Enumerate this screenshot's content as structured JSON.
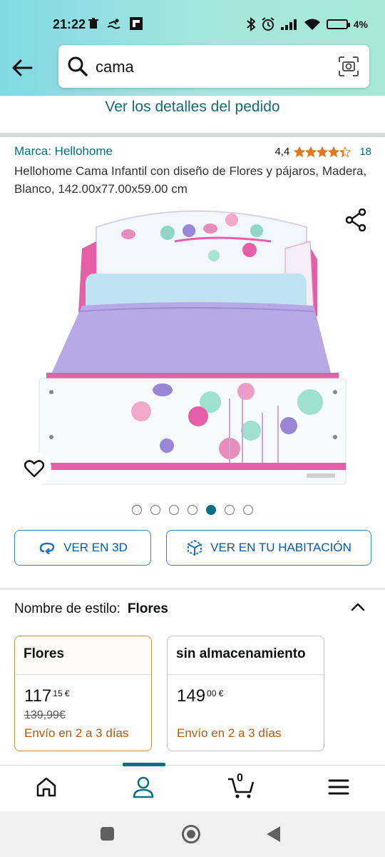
{
  "status": {
    "time": "21:22",
    "battery": "4%",
    "icons": [
      "trash-icon",
      "swim-icon",
      "flipboard-icon",
      "bluetooth-icon",
      "alarm-icon",
      "signal-icon",
      "wifi-icon",
      "battery-icon"
    ]
  },
  "search": {
    "query": "cama"
  },
  "order_details_link": "Ver los detalles del pedido",
  "product": {
    "brand": "Marca: Hellohome",
    "rating": "4,4",
    "stars": 4.4,
    "rating_count": "18",
    "title": "Hellohome Cama Infantil con diseño de Flores y pájaros, Madera, Blanco, 142.00x77.00x59.00 cm",
    "image_count": 7,
    "active_image": 5
  },
  "buttons": {
    "view_3d": "VER EN 3D",
    "view_room": "VER EN TU HABITACIÓN"
  },
  "style": {
    "label": "Nombre de estilo:",
    "selected": "Flores",
    "options": [
      {
        "name": "Flores",
        "price_main": "117",
        "price_cents": "15 €",
        "old_price": "139,99€",
        "delivery": "Envío en 2 a 3 días"
      },
      {
        "name": "sin almacenamiento",
        "price_main": "149",
        "price_cents": "00 €",
        "old_price": "",
        "delivery": "Envío en 2 a 3 días"
      }
    ]
  },
  "bottom_nav": {
    "items": [
      "home-icon",
      "account-icon",
      "cart-icon",
      "menu-icon"
    ],
    "cart_count": "0",
    "active": "account"
  },
  "colors": {
    "header_gradient_start": "#82d8e3",
    "header_gradient_end": "#a9e8d6",
    "link": "#007185",
    "star": "#de7921",
    "delivery": "#c45500",
    "selected_border": "#c59545"
  }
}
